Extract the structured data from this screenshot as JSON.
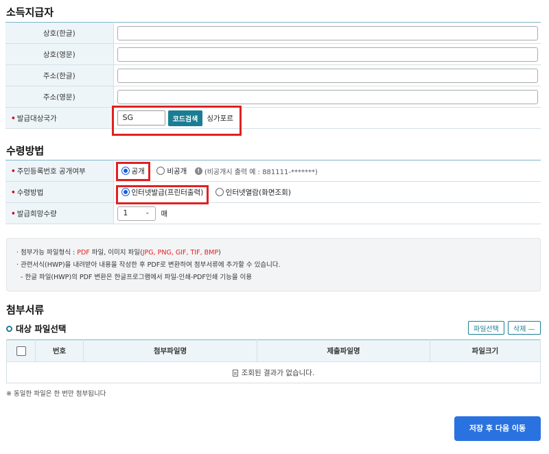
{
  "payer": {
    "title": "소득지급자",
    "name_ko_label": "상호(한글)",
    "name_en_label": "상호(영문)",
    "addr_ko_label": "주소(한글)",
    "addr_en_label": "주소(영문)",
    "country_label": "발급대상국가",
    "country_code": "SG",
    "search_button": "코드검색",
    "country_name": "싱가포르"
  },
  "receipt": {
    "title": "수령방법",
    "id_disclosure_label": "주민등록번호 공개여부",
    "option_public": "공개",
    "option_private": "비공개",
    "private_note": "(비공개시 출력 예 : 881111-*******)",
    "method_label": "수령방법",
    "option_internet_issue": "인터넷발급(프린터출력)",
    "option_internet_view": "인터넷열람(화면조회)",
    "quantity_label": "발급희망수량",
    "quantity_value": "1",
    "quantity_unit": "매"
  },
  "guide": {
    "line1_prefix": "첨부가능 파일형식 : ",
    "line1_pdf": "PDF",
    "line1_mid": " 파일, 이미지 파일(",
    "line1_formats": "JPG, PNG, GIF, TIF, BMP",
    "line1_suffix": ")",
    "line2": "관련서식(HWP)을 내려받아 내용을 작성한 후 PDF로 변환하여 첨부서류에 추가할 수 있습니다.",
    "line3": "- 한글 파일(HWP)의 PDF 변환은 한글프로그램에서 파일-인쇄-PDF인쇄 기능을 이용"
  },
  "attachments": {
    "title": "첨부서류",
    "subtitle": "대상 파일선택",
    "select_button": "파일선택",
    "delete_button": "삭제 —",
    "columns": [
      "번호",
      "첨부파일명",
      "제출파일명",
      "파일크기"
    ],
    "empty_message": "조회된 결과가 없습니다.",
    "footnote": "※ 동일한 파일은 한 번만 첨부됩니다"
  },
  "actions": {
    "save_next": "저장 후 다음 이동"
  },
  "colors": {
    "accent": "#1a7d93",
    "primary": "#2a72e0",
    "highlight": "#e02020"
  }
}
